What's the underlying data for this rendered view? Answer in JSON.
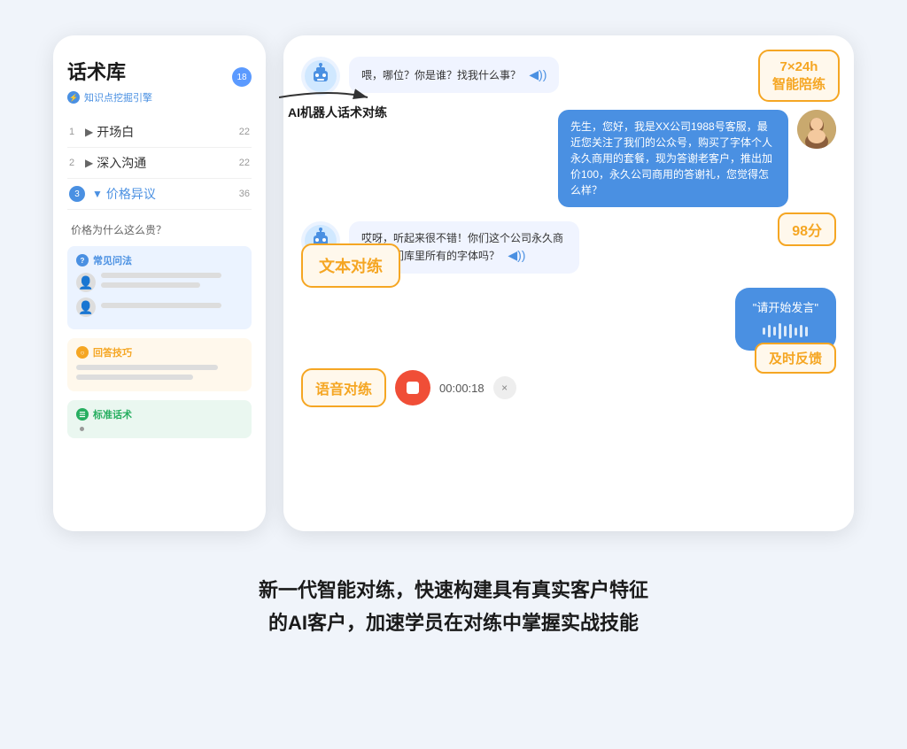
{
  "page": {
    "background": "#f0f4fa"
  },
  "phone": {
    "title": "话术库",
    "subtitle": "知识点挖掘引擎",
    "badge": "18",
    "menu": [
      {
        "num": "1",
        "arrow": "▶",
        "label": "开场白",
        "count": "22",
        "active": false
      },
      {
        "num": "2",
        "arrow": "▶",
        "label": "深入沟通",
        "count": "22",
        "active": false
      },
      {
        "num": "3",
        "arrow": "▼",
        "label": "价格异议",
        "count": "36",
        "active": true
      }
    ],
    "sub_question": "价格为什么这么贵？",
    "sections": [
      {
        "type": "blue",
        "icon": "?",
        "label": "常见问法"
      },
      {
        "type": "yellow",
        "icon": "○",
        "label": "回答技巧"
      },
      {
        "type": "green",
        "icon": "☰",
        "label": "标准话术"
      }
    ]
  },
  "arrow": {
    "label": "AI机器人话术对练"
  },
  "chat": {
    "badge_724": "7×24h\n智能陪练",
    "badge_score": "98分",
    "badge_feedback": "及时反馈",
    "badge_text_practice": "文本对练",
    "badge_voice_practice": "语音对练",
    "messages": [
      {
        "type": "robot",
        "text": "喂，哪位？你是谁？找我什么事？",
        "side": "left"
      },
      {
        "type": "human",
        "text": "先生，您好，我是XX公司1988号客服，最近您关注了我们的公众号，购买了字体个人永久商用的套餐，现为答谢老客户，推出加价100，永久公司商用的答谢礼，您觉得怎么样？",
        "side": "right"
      },
      {
        "type": "robot",
        "text": "哎呀，听起来很不错！你们这个公司永久商用是你们库里所有的字体吗？",
        "side": "left"
      },
      {
        "type": "voice_input",
        "text": "\"请开始发言\"",
        "side": "right"
      }
    ],
    "voice_timer": "00:00:18",
    "voice_close": "×"
  },
  "bottom_text": {
    "line1": "新一代智能对练，快速构建具有真实客户特征",
    "line2": "的AI客户，加速学员在对练中掌握实战技能"
  }
}
